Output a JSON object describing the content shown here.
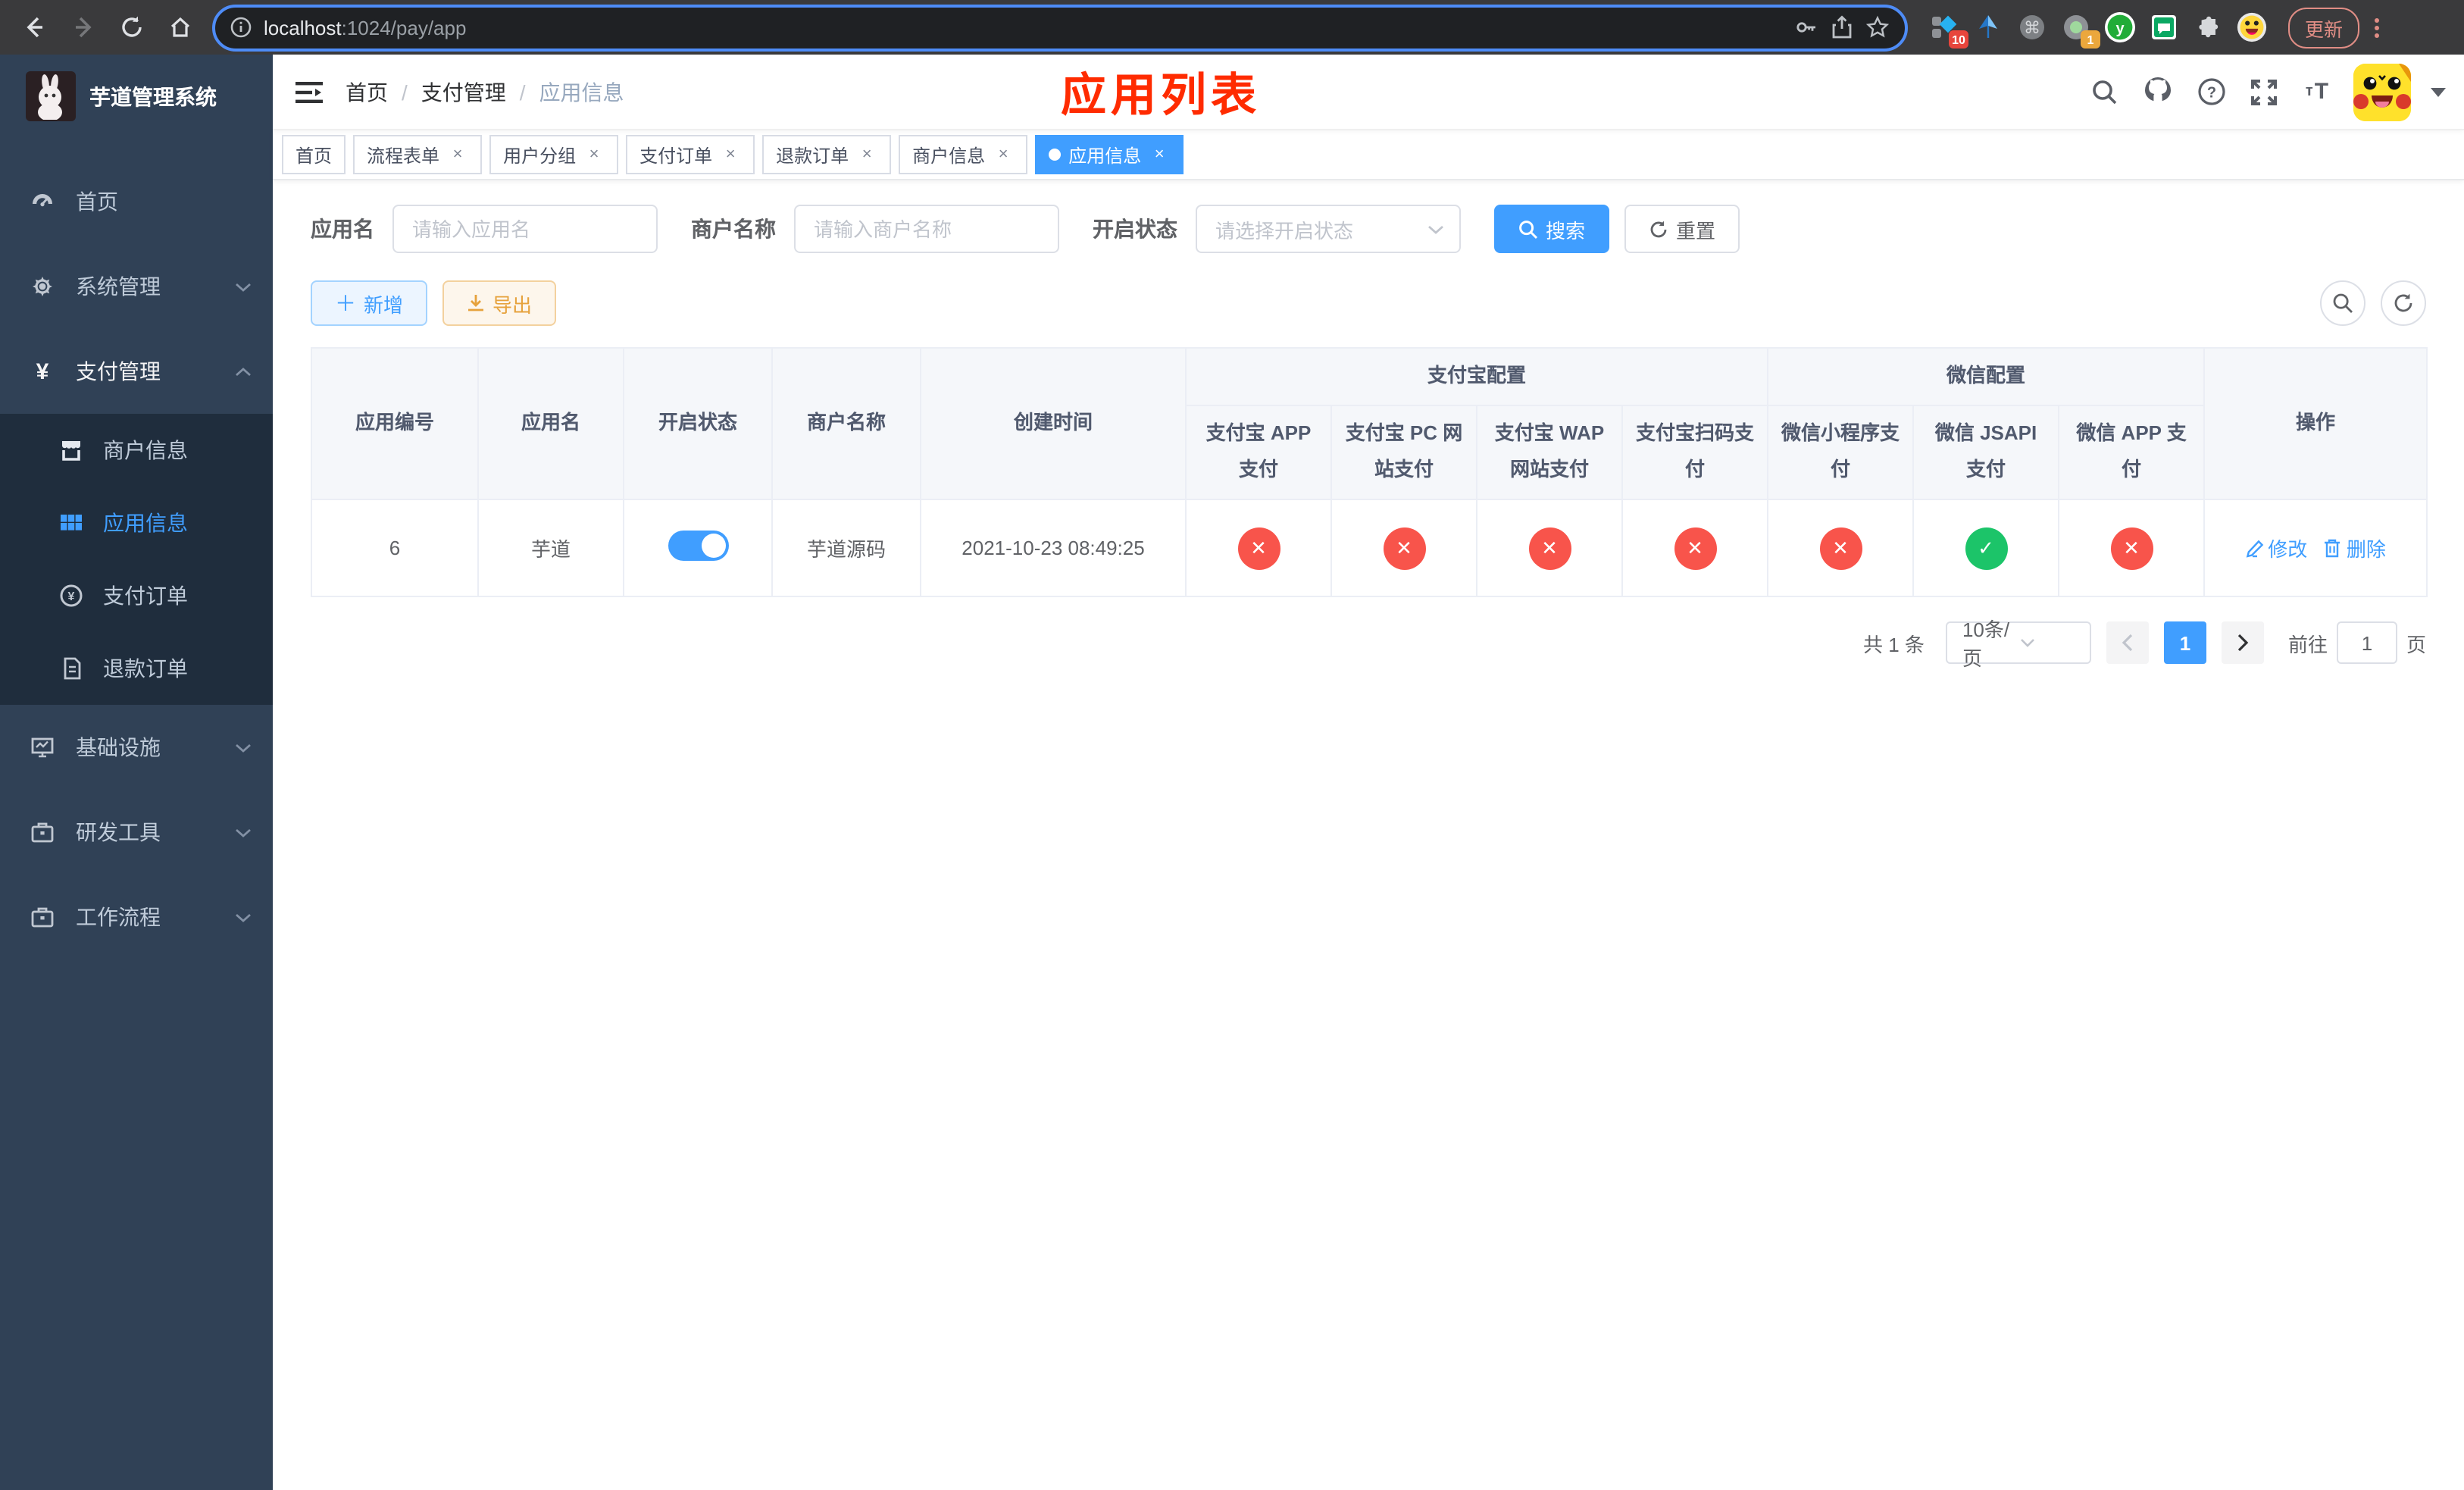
{
  "colors": {
    "accent": "#409eff",
    "danger": "#f8544b",
    "success": "#1cc469",
    "warning": "#e6a23c",
    "annotation_red": "#ff2b00",
    "sidebar_bg": "#304156",
    "submenu_bg": "#1f2d3d"
  },
  "browser": {
    "url_host": "localhost",
    "url_path": ":1024/pay/app",
    "update_label": "更新",
    "ext_badge_blue_diamond": "10",
    "ext_badge_record": "1"
  },
  "sidebar": {
    "title": "芋道管理系统",
    "items": [
      {
        "label": "首页"
      },
      {
        "label": "系统管理"
      },
      {
        "label": "支付管理"
      }
    ],
    "submenu": [
      {
        "label": "商户信息"
      },
      {
        "label": "应用信息"
      },
      {
        "label": "支付订单"
      },
      {
        "label": "退款订单"
      }
    ],
    "items_bottom": [
      {
        "label": "基础设施"
      },
      {
        "label": "研发工具"
      },
      {
        "label": "工作流程"
      }
    ]
  },
  "header": {
    "breadcrumb": [
      "首页",
      "支付管理",
      "应用信息"
    ]
  },
  "annotation": "应用列表",
  "tabs": [
    {
      "label": "首页"
    },
    {
      "label": "流程表单"
    },
    {
      "label": "用户分组"
    },
    {
      "label": "支付订单"
    },
    {
      "label": "退款订单"
    },
    {
      "label": "商户信息"
    },
    {
      "label": "应用信息"
    }
  ],
  "filters": {
    "app_name_label": "应用名",
    "app_name_placeholder": "请输入应用名",
    "merchant_label": "商户名称",
    "merchant_placeholder": "请输入商户名称",
    "status_label": "开启状态",
    "status_placeholder": "请选择开启状态",
    "search_label": "搜索",
    "reset_label": "重置"
  },
  "toolbar": {
    "add_label": "新增",
    "export_label": "导出"
  },
  "table": {
    "cols_left": [
      "应用编号",
      "应用名",
      "开启状态",
      "商户名称",
      "创建时间"
    ],
    "group_alipay": {
      "label": "支付宝配置",
      "cols": [
        "支付宝 APP 支付",
        "支付宝 PC 网站支付",
        "支付宝 WAP 网站支付",
        "支付宝扫码支付"
      ]
    },
    "group_wechat": {
      "label": "微信配置",
      "cols": [
        "微信小程序支付",
        "微信 JSAPI 支付",
        "微信 APP 支付"
      ]
    },
    "col_action": "操作",
    "row": {
      "id": "6",
      "name": "芋道",
      "enabled": true,
      "merchant": "芋道源码",
      "created": "2021-10-23 08:49:25",
      "pay_status": [
        "no",
        "no",
        "no",
        "no",
        "no",
        "yes",
        "no"
      ],
      "edit_label": "修改",
      "delete_label": "删除"
    }
  },
  "pagination": {
    "total": "共 1 条",
    "page_size": "10条/页",
    "current_page": "1",
    "goto_label": "前往",
    "goto_value": "1",
    "page_label": "页"
  }
}
